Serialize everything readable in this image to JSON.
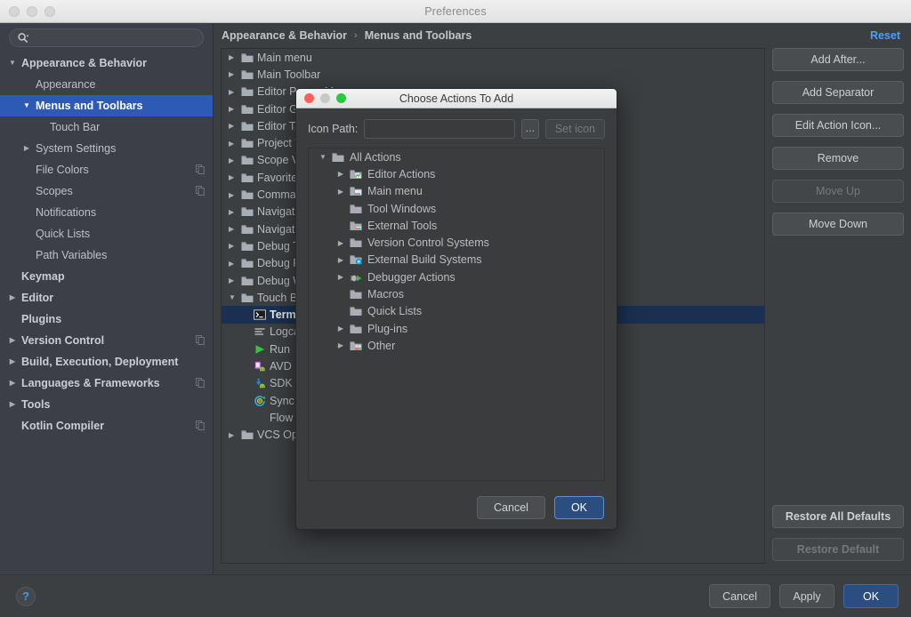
{
  "window": {
    "title": "Preferences"
  },
  "search": {
    "value": "",
    "placeholder": ""
  },
  "sidebar": {
    "items": [
      {
        "label": "Appearance & Behavior",
        "arrow": "▼",
        "indent": 0,
        "bold": true,
        "selected": false,
        "copy": false
      },
      {
        "label": "Appearance",
        "arrow": "",
        "indent": 1,
        "bold": false,
        "selected": false,
        "copy": false
      },
      {
        "label": "Menus and Toolbars",
        "arrow": "▼",
        "indent": 1,
        "bold": true,
        "selected": true,
        "copy": false
      },
      {
        "label": "Touch Bar",
        "arrow": "",
        "indent": 2,
        "bold": false,
        "selected": false,
        "copy": false
      },
      {
        "label": "System Settings",
        "arrow": "▶",
        "indent": 1,
        "bold": false,
        "selected": false,
        "copy": false
      },
      {
        "label": "File Colors",
        "arrow": "",
        "indent": 1,
        "bold": false,
        "selected": false,
        "copy": true
      },
      {
        "label": "Scopes",
        "arrow": "",
        "indent": 1,
        "bold": false,
        "selected": false,
        "copy": true
      },
      {
        "label": "Notifications",
        "arrow": "",
        "indent": 1,
        "bold": false,
        "selected": false,
        "copy": false
      },
      {
        "label": "Quick Lists",
        "arrow": "",
        "indent": 1,
        "bold": false,
        "selected": false,
        "copy": false
      },
      {
        "label": "Path Variables",
        "arrow": "",
        "indent": 1,
        "bold": false,
        "selected": false,
        "copy": false
      },
      {
        "label": "Keymap",
        "arrow": "",
        "indent": 0,
        "bold": true,
        "selected": false,
        "copy": false
      },
      {
        "label": "Editor",
        "arrow": "▶",
        "indent": 0,
        "bold": true,
        "selected": false,
        "copy": false
      },
      {
        "label": "Plugins",
        "arrow": "",
        "indent": 0,
        "bold": true,
        "selected": false,
        "copy": false
      },
      {
        "label": "Version Control",
        "arrow": "▶",
        "indent": 0,
        "bold": true,
        "selected": false,
        "copy": true
      },
      {
        "label": "Build, Execution, Deployment",
        "arrow": "▶",
        "indent": 0,
        "bold": true,
        "selected": false,
        "copy": false
      },
      {
        "label": "Languages & Frameworks",
        "arrow": "▶",
        "indent": 0,
        "bold": true,
        "selected": false,
        "copy": true
      },
      {
        "label": "Tools",
        "arrow": "▶",
        "indent": 0,
        "bold": true,
        "selected": false,
        "copy": false
      },
      {
        "label": "Kotlin Compiler",
        "arrow": "",
        "indent": 0,
        "bold": true,
        "selected": false,
        "copy": true
      }
    ]
  },
  "breadcrumb": {
    "root": "Appearance & Behavior",
    "separator": "›",
    "leaf": "Menus and Toolbars",
    "reset": "Reset"
  },
  "main_tree": {
    "rows": [
      {
        "label": "Main menu",
        "arrow": "▶",
        "icon": "folder-icon",
        "indent": 0,
        "selected": false
      },
      {
        "label": "Main Toolbar",
        "arrow": "▶",
        "icon": "folder-icon",
        "indent": 0,
        "selected": false
      },
      {
        "label": "Editor Popup Menu",
        "arrow": "▶",
        "icon": "folder-icon",
        "indent": 0,
        "selected": false
      },
      {
        "label": "Editor Gutter Popup Menu",
        "arrow": "▶",
        "icon": "folder-icon",
        "indent": 0,
        "selected": false
      },
      {
        "label": "Editor Tab Popup Menu",
        "arrow": "▶",
        "icon": "folder-icon",
        "indent": 0,
        "selected": false
      },
      {
        "label": "Project View Popup Menu",
        "arrow": "▶",
        "icon": "folder-icon",
        "indent": 0,
        "selected": false
      },
      {
        "label": "Scope View Popup Menu",
        "arrow": "▶",
        "icon": "folder-icon",
        "indent": 0,
        "selected": false
      },
      {
        "label": "Favorites Popup Menu",
        "arrow": "▶",
        "icon": "folder-icon",
        "indent": 0,
        "selected": false
      },
      {
        "label": "Commander Popup Menu",
        "arrow": "▶",
        "icon": "folder-icon",
        "indent": 0,
        "selected": false
      },
      {
        "label": "Navigation Bar Toolbar",
        "arrow": "▶",
        "icon": "folder-icon",
        "indent": 0,
        "selected": false
      },
      {
        "label": "Navigation Bar Popup Menu",
        "arrow": "▶",
        "icon": "folder-icon",
        "indent": 0,
        "selected": false
      },
      {
        "label": "Debug Toolbar",
        "arrow": "▶",
        "icon": "folder-icon",
        "indent": 0,
        "selected": false
      },
      {
        "label": "Debug Popup Menu",
        "arrow": "▶",
        "icon": "folder-icon",
        "indent": 0,
        "selected": false
      },
      {
        "label": "Debug Watches Toolbar",
        "arrow": "▶",
        "icon": "folder-icon",
        "indent": 0,
        "selected": false
      },
      {
        "label": "Touch Bar",
        "arrow": "▼",
        "icon": "folder-icon",
        "indent": 0,
        "selected": false
      },
      {
        "label": "Terminal",
        "arrow": "",
        "icon": "terminal-icon",
        "indent": 1,
        "selected": true
      },
      {
        "label": "Logcat",
        "arrow": "",
        "icon": "logcat-icon",
        "indent": 1,
        "selected": false
      },
      {
        "label": "Run",
        "arrow": "",
        "icon": "run-icon",
        "indent": 1,
        "selected": false
      },
      {
        "label": "AVD Manager",
        "arrow": "",
        "icon": "avd-icon",
        "indent": 1,
        "selected": false
      },
      {
        "label": "SDK Manager",
        "arrow": "",
        "icon": "sdk-icon",
        "indent": 1,
        "selected": false
      },
      {
        "label": "Sync Project",
        "arrow": "",
        "icon": "sync-icon",
        "indent": 1,
        "selected": false
      },
      {
        "label": "Flow",
        "arrow": "",
        "icon": "none",
        "indent": 1,
        "selected": false
      },
      {
        "label": "VCS Operations Popup",
        "arrow": "▶",
        "icon": "folder-icon",
        "indent": 0,
        "selected": false
      }
    ]
  },
  "side_buttons": [
    {
      "label": "Add After...",
      "disabled": false
    },
    {
      "label": "Add Separator",
      "disabled": false
    },
    {
      "label": "Edit Action Icon...",
      "disabled": false
    },
    {
      "label": "Remove",
      "disabled": false
    },
    {
      "label": "Move Up",
      "disabled": true
    },
    {
      "label": "Move Down",
      "disabled": false
    }
  ],
  "restore_buttons": [
    {
      "label": "Restore All Defaults",
      "disabled": false
    },
    {
      "label": "Restore Default",
      "disabled": true
    }
  ],
  "bottom_bar": {
    "help": "?",
    "cancel": "Cancel",
    "apply": "Apply",
    "ok": "OK"
  },
  "dialog": {
    "title": "Choose Actions To Add",
    "icon_path_label": "Icon Path:",
    "icon_path_value": "",
    "icon_path_placeholder": "",
    "browse_label": "…",
    "set_icon_label": "Set icon",
    "set_icon_disabled": true,
    "tree": [
      {
        "label": "All Actions",
        "arrow": "▼",
        "icon": "folder-icon",
        "level": 0
      },
      {
        "label": "Editor Actions",
        "arrow": "▶",
        "icon": "editor-actions-icon",
        "level": 1
      },
      {
        "label": "Main menu",
        "arrow": "▶",
        "icon": "main-menu-icon",
        "level": 1
      },
      {
        "label": "Tool Windows",
        "arrow": "",
        "icon": "folder-icon",
        "level": 1
      },
      {
        "label": "External Tools",
        "arrow": "",
        "icon": "external-tools-icon",
        "level": 1
      },
      {
        "label": "Version Control Systems",
        "arrow": "▶",
        "icon": "folder-icon",
        "level": 1
      },
      {
        "label": "External Build Systems",
        "arrow": "▶",
        "icon": "build-systems-icon",
        "level": 1
      },
      {
        "label": "Debugger Actions",
        "arrow": "▶",
        "icon": "debugger-icon",
        "level": 1
      },
      {
        "label": "Macros",
        "arrow": "",
        "icon": "folder-icon",
        "level": 1
      },
      {
        "label": "Quick Lists",
        "arrow": "",
        "icon": "folder-icon",
        "level": 1
      },
      {
        "label": "Plug-ins",
        "arrow": "▶",
        "icon": "folder-icon",
        "level": 1
      },
      {
        "label": "Other",
        "arrow": "▶",
        "icon": "other-icon",
        "level": 1
      }
    ],
    "cancel": "Cancel",
    "ok": "OK"
  },
  "colors": {
    "window_bg": "#3c3f41",
    "sidebar_bg": "#3c3f47",
    "dialog_bg": "#3b3c3e",
    "selection_blue": "#2d5ab5",
    "tree_selection": "#1b3050",
    "accent_link": "#4a9eff",
    "primary_button": "#2c4d80",
    "folder_icon": "#9aa0a6"
  }
}
